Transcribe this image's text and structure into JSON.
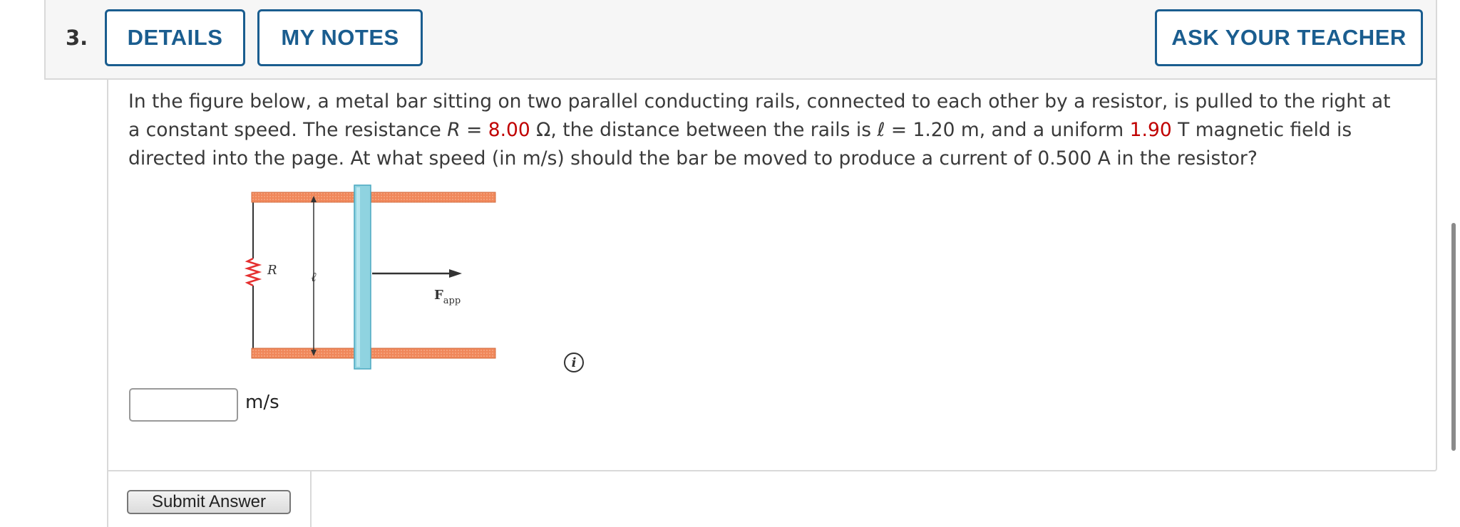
{
  "question": {
    "number": "3.",
    "text": {
      "seg1": "In the figure below, a metal bar sitting on two parallel conducting rails, connected to each other by a resistor, is pulled to the right at a constant speed. The resistance ",
      "var_R": "R",
      "seg2": " = ",
      "R_value": "8.00",
      "seg3": " Ω, the distance between the rails is ℓ = 1.20 m, and a uniform ",
      "B_value": "1.90",
      "seg4": " T magnetic field is directed into the page. At what speed (in m/s) should the bar be moved to produce a current of 0.500 A in the resistor?"
    }
  },
  "toolbar": {
    "details_label": "DETAILS",
    "notes_label": "MY NOTES",
    "ask_label": "ASK YOUR TEACHER"
  },
  "figure": {
    "resistor_label": "R",
    "length_label": "ℓ",
    "force_label_main": "F",
    "force_label_sub": "app"
  },
  "answer": {
    "value": "",
    "unit": "m/s"
  },
  "submit": {
    "label": "Submit Answer"
  },
  "colors": {
    "accent": "#1a5d8f",
    "highlight_red": "#c00000",
    "rail": "#f0875a",
    "bar": "#8fd3e0"
  }
}
